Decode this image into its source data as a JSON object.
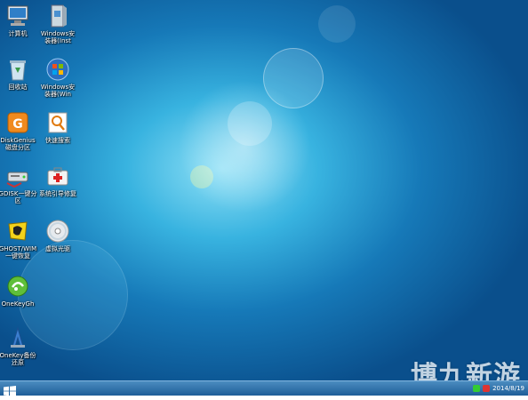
{
  "desktop": {
    "icons": [
      {
        "label": "计算机",
        "icon": "computer-icon"
      },
      {
        "label": "Windows安\n装器(Inst",
        "icon": "installer-icon"
      },
      {
        "label": "回收站",
        "icon": "recycle-bin-icon"
      },
      {
        "label": "Windows安\n装器(Win",
        "icon": "windows-logo-icon"
      },
      {
        "label": "DiskGenius\n磁盘分区",
        "icon": "diskgenius-icon"
      },
      {
        "label": "快速搜索",
        "icon": "quick-search-icon"
      },
      {
        "label": "GDISK一键分\n区",
        "icon": "gdisk-icon"
      },
      {
        "label": "系统引导修复",
        "icon": "boot-repair-icon"
      },
      {
        "label": "GHOST/WIM\n一键恢复",
        "icon": "ghost-icon"
      },
      {
        "label": "虚拟光驱",
        "icon": "virtual-drive-icon"
      },
      {
        "label": "OneKeyGh",
        "icon": "onekey-ghost-icon"
      },
      {
        "label": "OneKey备份\n还原",
        "icon": "onekey-backup-icon"
      }
    ]
  },
  "taskbar": {
    "clock_date": "2014/8/19"
  },
  "watermark": {
    "text": "博九新游"
  },
  "colors": {
    "accent": "#1679b8",
    "taskbar": "#2a6aa4"
  }
}
